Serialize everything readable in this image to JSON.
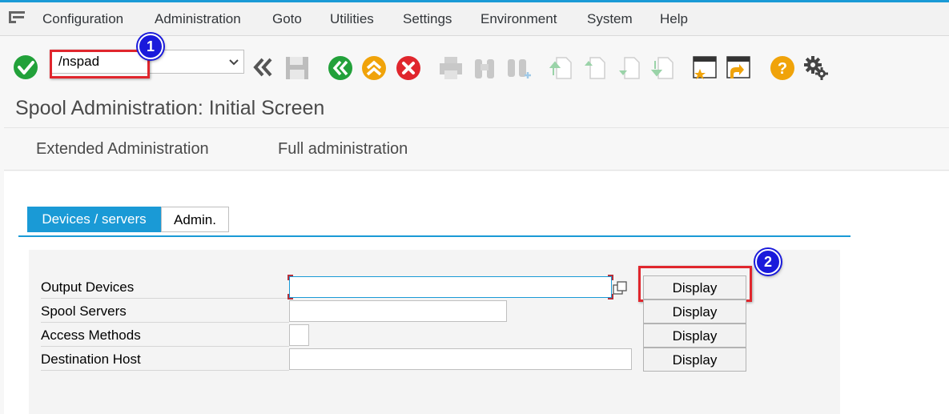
{
  "menu": {
    "items": [
      {
        "label": "Configuration"
      },
      {
        "label": "Administration"
      },
      {
        "label": "Goto"
      },
      {
        "label": "Utilities"
      },
      {
        "label": "Settings"
      },
      {
        "label": "Environment"
      },
      {
        "label": "System"
      },
      {
        "label": "Help"
      }
    ]
  },
  "toolbar": {
    "okcode_value": "/nspad",
    "icons": [
      "enter-icon",
      "collapse-icon",
      "save-icon",
      "back-icon",
      "exit-icon",
      "cancel-icon",
      "print-icon",
      "find-icon",
      "find-next-icon",
      "first-page-icon",
      "previous-page-icon",
      "next-page-icon",
      "last-page-icon",
      "create-session-icon",
      "shortcut-icon",
      "help-icon",
      "customize-layout-icon"
    ]
  },
  "annotations": {
    "badge1": "1",
    "badge2": "2"
  },
  "page": {
    "title": "Spool Administration: Initial Screen"
  },
  "appbar": {
    "extended": "Extended Administration",
    "full": "Full administration"
  },
  "tabs": {
    "active": "Devices / servers",
    "inactive": "Admin."
  },
  "rows": [
    {
      "label": "Output Devices",
      "value": "",
      "button": "Display"
    },
    {
      "label": "Spool Servers",
      "value": "",
      "button": "Display"
    },
    {
      "label": "Access Methods",
      "value": "",
      "button": "Display"
    },
    {
      "label": "Destination Host",
      "value": "",
      "button": "Display"
    }
  ],
  "colors": {
    "accent": "#1a9ad6",
    "highlight": "#e0262d",
    "badge": "#1a1adb",
    "ok_green": "#22a13a",
    "cancel_red": "#e0262d",
    "help_orange": "#f0a30a"
  }
}
